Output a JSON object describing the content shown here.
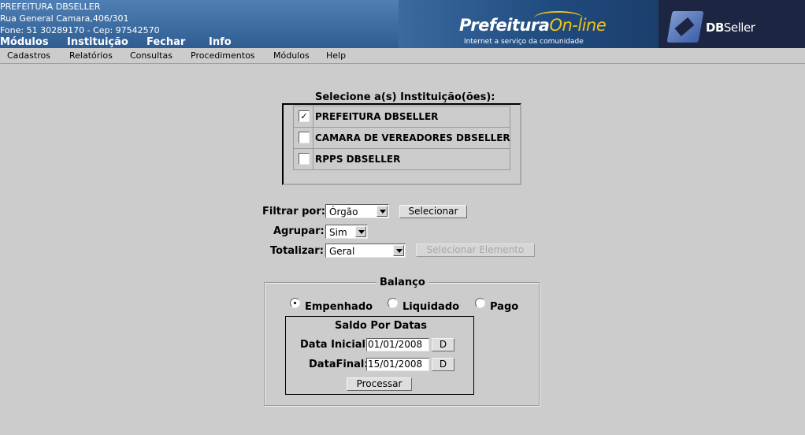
{
  "header": {
    "org_name": "PREFEITURA DBSELLER",
    "address": "Rua General Camara,406/301",
    "phone": "Fone: 51 30289170  -  Cep: 97542570",
    "nav": [
      "Módulos",
      "Instituição",
      "Fechar",
      "Info"
    ],
    "banner_brand": "Prefeitura",
    "banner_brand_suffix": "On-line",
    "banner_tagline": "Internet a serviço da comunidade",
    "vendor_logo": "DB",
    "vendor_logo_suffix": "Seller"
  },
  "menubar": [
    "Cadastros",
    "Relatórios",
    "Consultas",
    "Procedimentos",
    "Módulos",
    "Help"
  ],
  "institutions": {
    "title": "Selecione a(s) Instituição(ões):",
    "items": [
      {
        "label": "PREFEITURA DBSELLER",
        "checked": true,
        "mark": "✓"
      },
      {
        "label": "CAMARA DE VEREADORES DBSELLER",
        "checked": false,
        "mark": ""
      },
      {
        "label": "RPPS DBSELLER",
        "checked": false,
        "mark": ""
      }
    ]
  },
  "form": {
    "filtrar_label": "Filtrar por:",
    "filtrar_value": "Órgão",
    "selecionar_button": "Selecionar",
    "agrupar_label": "Agrupar:",
    "agrupar_value": "Sim",
    "totalizar_label": "Totalizar:",
    "totalizar_value": "Geral",
    "selecionar_elemento_button": "Selecionar Elemento"
  },
  "balanco": {
    "legend": "Balanço",
    "options": [
      {
        "label": "Empenhado",
        "selected": true
      },
      {
        "label": "Liquidado",
        "selected": false
      },
      {
        "label": "Pago",
        "selected": false
      }
    ],
    "saldo_title": "Saldo Por Datas",
    "data_inicial_label": "Data Inicial:",
    "data_inicial_value": "01/01/2008",
    "data_final_label": "DataFinal:",
    "data_final_value": "15/01/2008",
    "date_button": "D",
    "processar_button": "Processar"
  }
}
